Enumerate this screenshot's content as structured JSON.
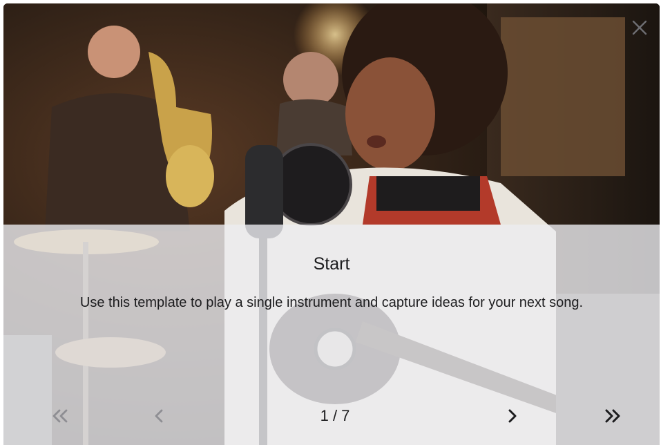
{
  "dialog": {
    "image": {
      "description_icon": "photo-singer-guitar"
    },
    "close_icon": "close-icon",
    "slide": {
      "title": "Start",
      "description": "Use this template to play a single instrument and capture ideas for your next song."
    },
    "pagination": {
      "current": 1,
      "total": 7,
      "label": "1 / 7"
    },
    "nav_icons": {
      "first": "double-chevron-left-icon",
      "previous": "chevron-left-icon",
      "next": "chevron-right-icon",
      "last": "double-chevron-right-icon"
    },
    "colors": {
      "overlay": "#ECECF0",
      "text": "#1C1C1E",
      "nav_disabled": "#8E8E93",
      "nav_enabled": "#1C1C1E"
    }
  }
}
